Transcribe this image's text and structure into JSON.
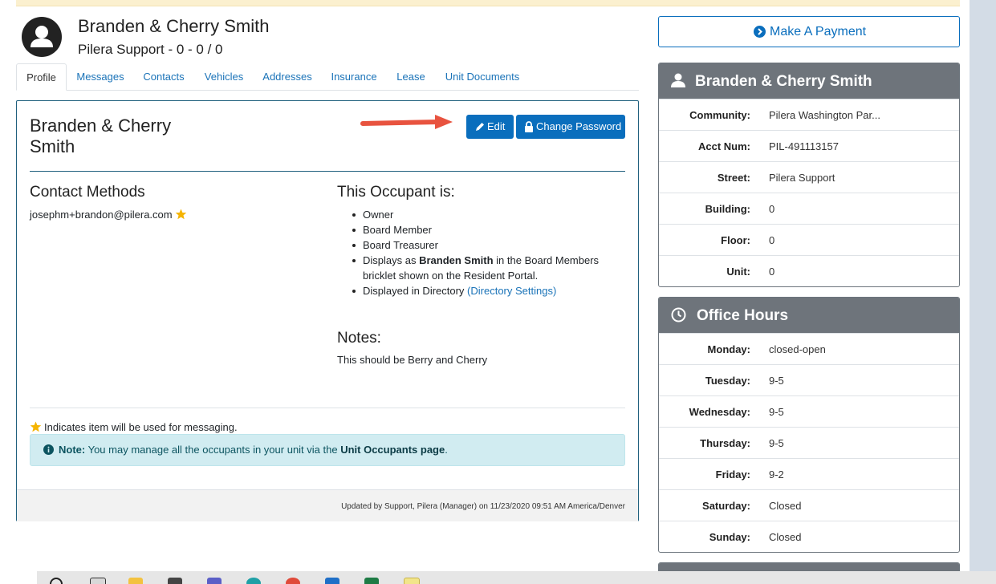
{
  "header": {
    "unit_name": "Branden & Cherry Smith",
    "unit_sub": "Pilera Support - 0 - 0 / 0"
  },
  "tabs": [
    {
      "label": "Profile"
    },
    {
      "label": "Messages"
    },
    {
      "label": "Contacts"
    },
    {
      "label": "Vehicles"
    },
    {
      "label": "Addresses"
    },
    {
      "label": "Insurance"
    },
    {
      "label": "Lease"
    },
    {
      "label": "Unit Documents"
    }
  ],
  "profile": {
    "title": "Branden & Cherry Smith",
    "edit_label": "Edit",
    "change_password_label": "Change Password",
    "contact_methods_heading": "Contact Methods",
    "email": "josephm+brandon@pilera.com",
    "occupant_heading": "This Occupant is:",
    "occupant_items": {
      "owner": "Owner",
      "board_member": "Board Member",
      "board_treasurer": "Board Treasurer",
      "displays_prefix": "Displays as ",
      "displays_name": "Branden Smith",
      "displays_suffix": " in the Board Members bricklet shown on the Resident Portal.",
      "directory_prefix": "Displayed in Directory ",
      "directory_link": "(Directory Settings)"
    },
    "notes_heading": "Notes:",
    "notes_text": "This should be Berry and Cherry",
    "legend_text": "Indicates item will be used for messaging.",
    "alert": {
      "label": "Note:",
      "text": " You may manage all the occupants in your unit via the ",
      "link": "Unit Occupants page",
      "end": "."
    },
    "footer": "Updated by Support, Pilera (Manager) on 11/23/2020 09:51 AM America/Denver"
  },
  "sidebar": {
    "payment_label": "Make A Payment",
    "unit_panel": {
      "title": "Branden & Cherry Smith",
      "rows": [
        {
          "key": "Community:",
          "value": "Pilera Washington Par..."
        },
        {
          "key": "Acct Num:",
          "value": "PIL-491113157"
        },
        {
          "key": "Street:",
          "value": "Pilera Support"
        },
        {
          "key": "Building:",
          "value": "0"
        },
        {
          "key": "Floor:",
          "value": "0"
        },
        {
          "key": "Unit:",
          "value": "0"
        }
      ]
    },
    "hours_panel": {
      "title": "Office Hours",
      "rows": [
        {
          "key": "Monday:",
          "value": "closed-open"
        },
        {
          "key": "Tuesday:",
          "value": "9-5"
        },
        {
          "key": "Wednesday:",
          "value": "9-5"
        },
        {
          "key": "Thursday:",
          "value": "9-5"
        },
        {
          "key": "Friday:",
          "value": "9-2"
        },
        {
          "key": "Saturday:",
          "value": "Closed"
        },
        {
          "key": "Sunday:",
          "value": "Closed"
        }
      ]
    }
  },
  "colors": {
    "primary": "#0a6ebd",
    "panel_header": "#6e747b",
    "card_border": "#20607e",
    "alert_bg": "#d1ecf1",
    "arrow": "#e8533f",
    "star": "#f5b400"
  }
}
